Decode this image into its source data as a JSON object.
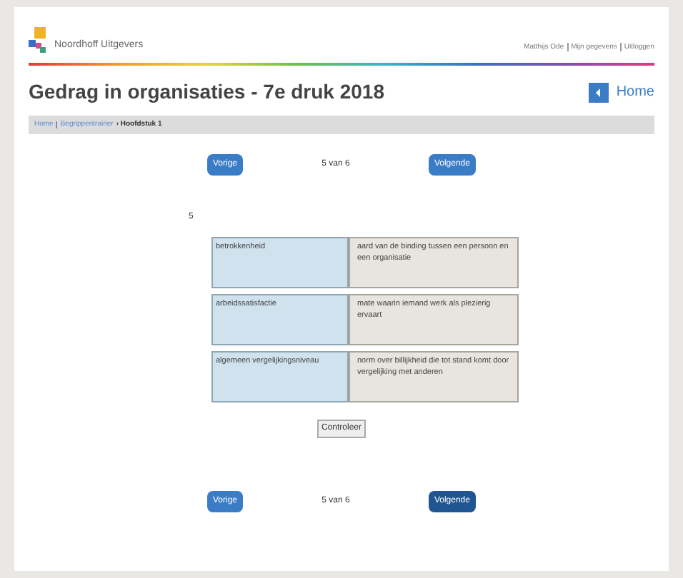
{
  "header": {
    "brand": "Noordhoff Uitgevers",
    "user_links": [
      "Matthijs Ode",
      "Mijn gegevens",
      "Uitloggen"
    ]
  },
  "title": "Gedrag in organisaties - 7e druk 2018",
  "home_button": {
    "label": "Home"
  },
  "breadcrumb": {
    "links": [
      "Home",
      "Begrippentrainer"
    ],
    "current": "› Hoofdstuk 1"
  },
  "nav_top": {
    "previous": {
      "label": "Vorige",
      "highlighted": false
    },
    "counter": "5 van 6",
    "next": {
      "label": "Volgende",
      "highlighted": false
    }
  },
  "question_number": "5",
  "pairs": [
    {
      "term": "betrokkenheid",
      "definition": "aard van de binding tussen een persoon en een organisatie"
    },
    {
      "term": "arbeidssatisfactie",
      "definition": "mate waarin iemand werk als plezierig ervaart"
    },
    {
      "term": "algemeen vergelijkingsniveau",
      "definition": "norm over billijkheid die tot stand komt door vergelijking met anderen"
    }
  ],
  "check_button": "Controleer",
  "nav_bottom": {
    "previous": {
      "label": "Vorige",
      "highlighted": false
    },
    "counter": "5 van 6",
    "next": {
      "label": "Volgende",
      "highlighted": true
    }
  }
}
